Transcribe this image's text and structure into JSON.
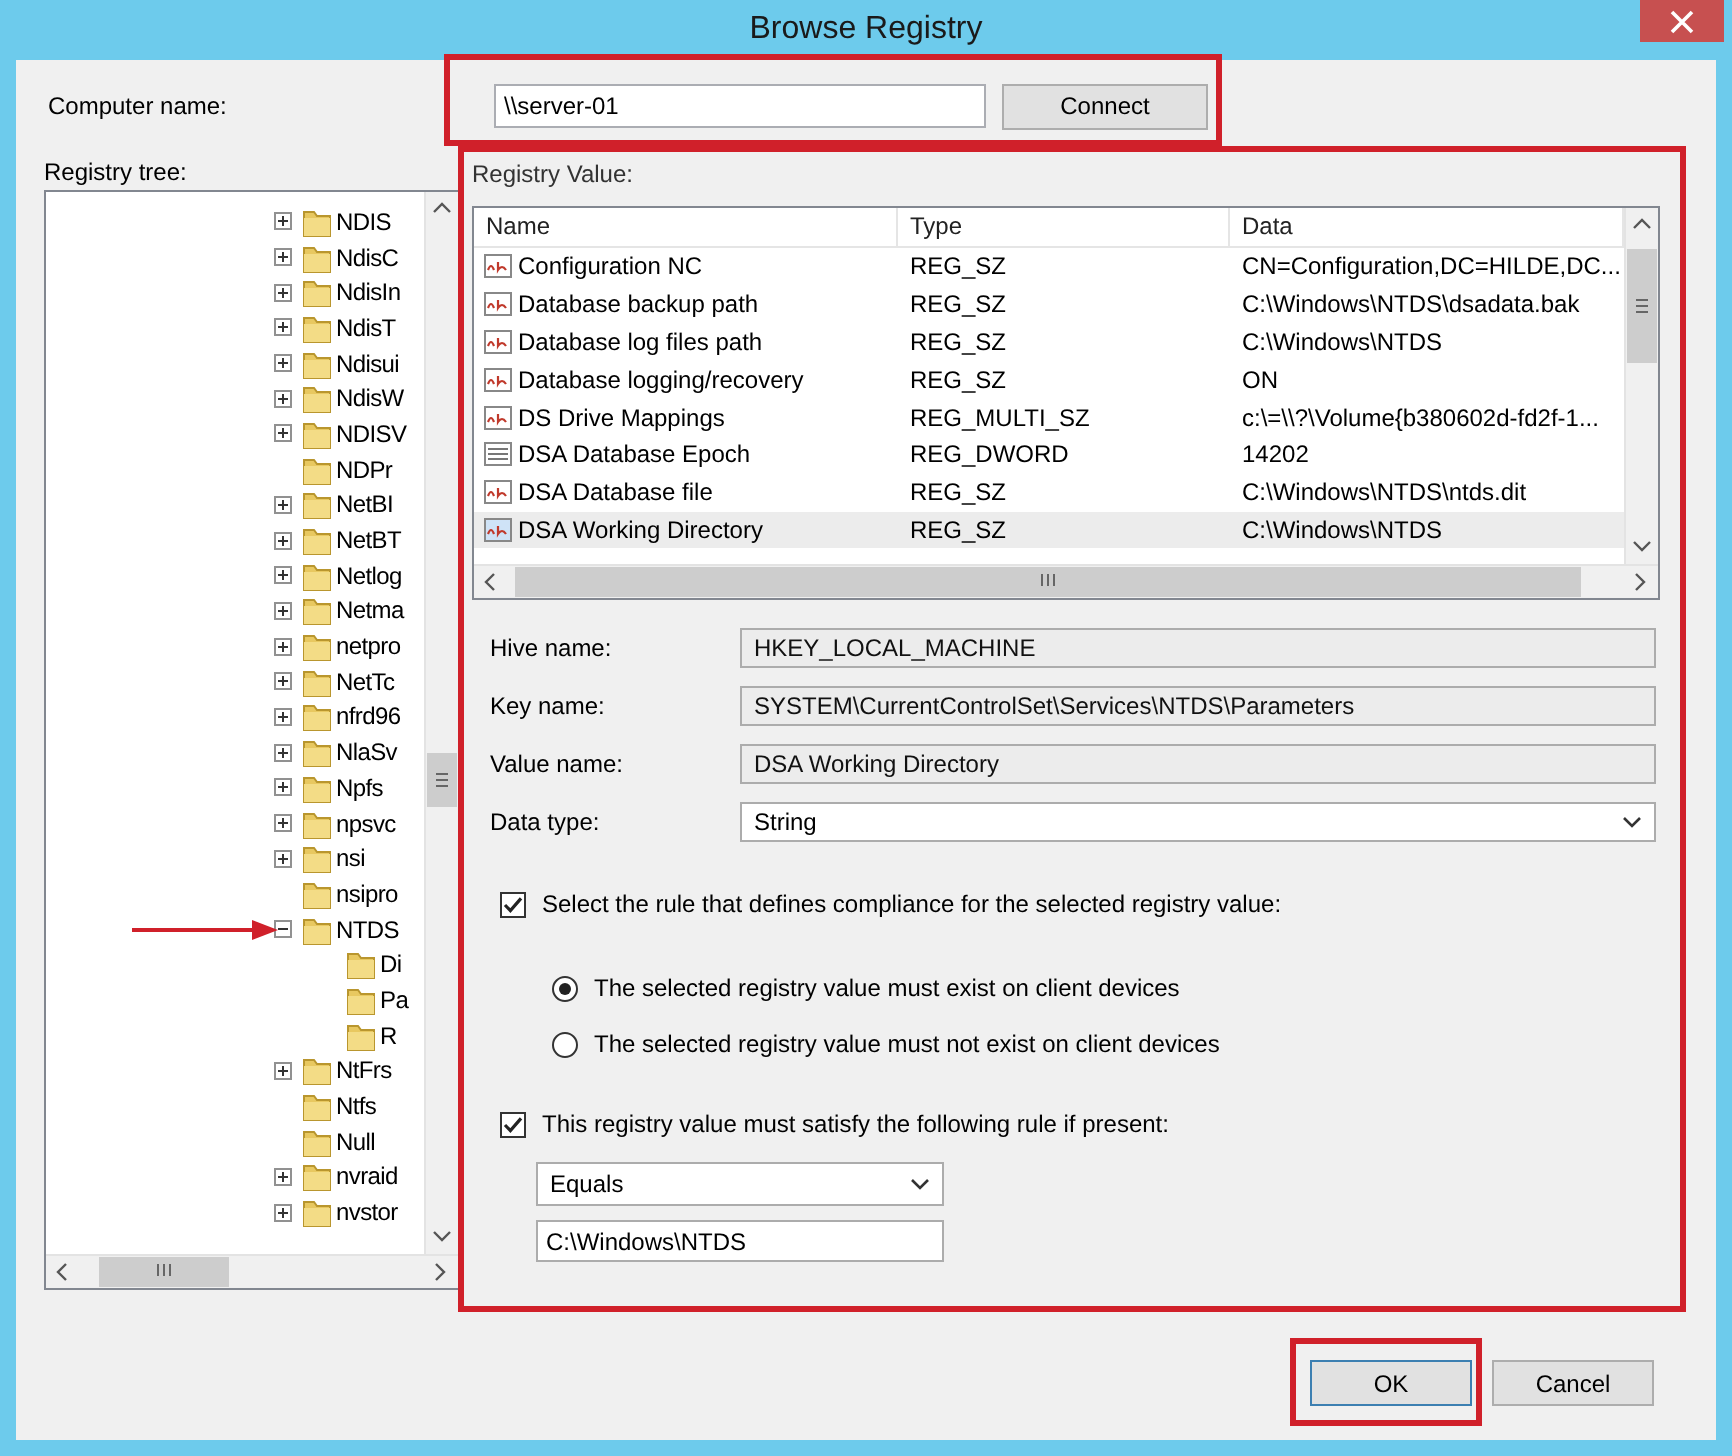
{
  "window": {
    "title": "Browse Registry"
  },
  "computer": {
    "label": "Computer name:",
    "value": "\\\\server-01",
    "button": "Connect"
  },
  "tree": {
    "label": "Registry tree:",
    "items": [
      {
        "label": "NDIS",
        "expandable": true,
        "expanded": false
      },
      {
        "label": "NdisC",
        "expandable": true,
        "expanded": false
      },
      {
        "label": "NdisIn",
        "expandable": true,
        "expanded": false
      },
      {
        "label": "NdisT",
        "expandable": true,
        "expanded": false
      },
      {
        "label": "Ndisui",
        "expandable": true,
        "expanded": false
      },
      {
        "label": "NdisW",
        "expandable": true,
        "expanded": false
      },
      {
        "label": "NDISV",
        "expandable": true,
        "expanded": false
      },
      {
        "label": "NDPr",
        "expandable": false,
        "expanded": false
      },
      {
        "label": "NetBI",
        "expandable": true,
        "expanded": false
      },
      {
        "label": "NetBT",
        "expandable": true,
        "expanded": false
      },
      {
        "label": "Netlog",
        "expandable": true,
        "expanded": false
      },
      {
        "label": "Netma",
        "expandable": true,
        "expanded": false
      },
      {
        "label": "netpro",
        "expandable": true,
        "expanded": false
      },
      {
        "label": "NetTc",
        "expandable": true,
        "expanded": false
      },
      {
        "label": "nfrd96",
        "expandable": true,
        "expanded": false
      },
      {
        "label": "NlaSv",
        "expandable": true,
        "expanded": false
      },
      {
        "label": "Npfs",
        "expandable": true,
        "expanded": false
      },
      {
        "label": "npsvc",
        "expandable": true,
        "expanded": false
      },
      {
        "label": "nsi",
        "expandable": true,
        "expanded": false
      },
      {
        "label": "nsipro",
        "expandable": false,
        "expanded": false
      },
      {
        "label": "NTDS",
        "expandable": true,
        "expanded": true,
        "children": [
          {
            "label": "Di",
            "expandable": false,
            "expanded": false
          },
          {
            "label": "Pa",
            "expandable": false,
            "expanded": false
          },
          {
            "label": "R",
            "expandable": false,
            "expanded": false
          }
        ]
      },
      {
        "label": "NtFrs",
        "expandable": true,
        "expanded": false
      },
      {
        "label": "Ntfs",
        "expandable": false,
        "expanded": false
      },
      {
        "label": "Null",
        "expandable": false,
        "expanded": false
      },
      {
        "label": "nvraid",
        "expandable": true,
        "expanded": false
      },
      {
        "label": "nvstor",
        "expandable": true,
        "expanded": false
      }
    ]
  },
  "registry_value": {
    "label": "Registry Value:",
    "columns": [
      "Name",
      "Type",
      "Data"
    ],
    "rows": [
      {
        "kind": "string",
        "name": "Configuration NC",
        "type": "REG_SZ",
        "data": "CN=Configuration,DC=HILDE,DC...",
        "selected": false
      },
      {
        "kind": "string",
        "name": "Database backup path",
        "type": "REG_SZ",
        "data": "C:\\Windows\\NTDS\\dsadata.bak",
        "selected": false
      },
      {
        "kind": "string",
        "name": "Database log files path",
        "type": "REG_SZ",
        "data": "C:\\Windows\\NTDS",
        "selected": false
      },
      {
        "kind": "string",
        "name": "Database logging/recovery",
        "type": "REG_SZ",
        "data": "ON",
        "selected": false
      },
      {
        "kind": "string",
        "name": "DS Drive Mappings",
        "type": "REG_MULTI_SZ",
        "data": "c:\\=\\\\?\\Volume{b380602d-fd2f-1...",
        "selected": false
      },
      {
        "kind": "binary",
        "name": "DSA Database Epoch",
        "type": "REG_DWORD",
        "data": "14202",
        "selected": false
      },
      {
        "kind": "string",
        "name": "DSA Database file",
        "type": "REG_SZ",
        "data": "C:\\Windows\\NTDS\\ntds.dit",
        "selected": false
      },
      {
        "kind": "string",
        "name": "DSA Working Directory",
        "type": "REG_SZ",
        "data": "C:\\Windows\\NTDS",
        "selected": true
      }
    ]
  },
  "fields": [
    {
      "kind": "readonly",
      "label": "Hive name:",
      "value": "HKEY_LOCAL_MACHINE"
    },
    {
      "kind": "readonly",
      "label": "Key name:",
      "value": "SYSTEM\\CurrentControlSet\\Services\\NTDS\\Parameters"
    },
    {
      "kind": "readonly",
      "label": "Value name:",
      "value": "DSA Working Directory"
    },
    {
      "kind": "dropdown",
      "label": "Data type:",
      "value": "String"
    }
  ],
  "rule": {
    "label": "Select the rule that defines compliance for the selected registry value:",
    "checked": true,
    "options": [
      {
        "label": "The selected registry value must exist on client devices",
        "selected": true
      },
      {
        "label": "The selected registry value must not exist on client devices",
        "selected": false
      }
    ]
  },
  "condition": {
    "label": "This registry value must satisfy the following rule if present:",
    "checked": true,
    "operator": "Equals",
    "value": "C:\\Windows\\NTDS"
  },
  "buttons": [
    {
      "label": "OK",
      "default": true
    },
    {
      "label": "Cancel",
      "default": false
    }
  ]
}
